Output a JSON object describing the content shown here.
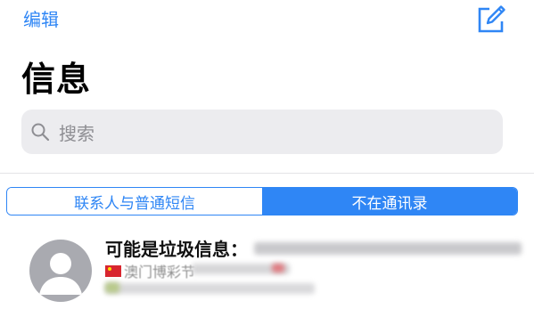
{
  "nav": {
    "edit_label": "编辑",
    "compose_icon": "compose-icon"
  },
  "page": {
    "title": "信息"
  },
  "search": {
    "placeholder": "搜索",
    "icon": "search-icon"
  },
  "segments": [
    {
      "label": "联系人与普通短信",
      "selected": false
    },
    {
      "label": "不在通讯录",
      "selected": true
    }
  ],
  "message": {
    "title": "可能是垃圾信息：",
    "preview": "澳门博彩节",
    "flag_icon": "flag-icon"
  },
  "colors": {
    "accent": "#2f86f5",
    "search_bg": "#ececef",
    "avatar": "#a9aab0"
  }
}
